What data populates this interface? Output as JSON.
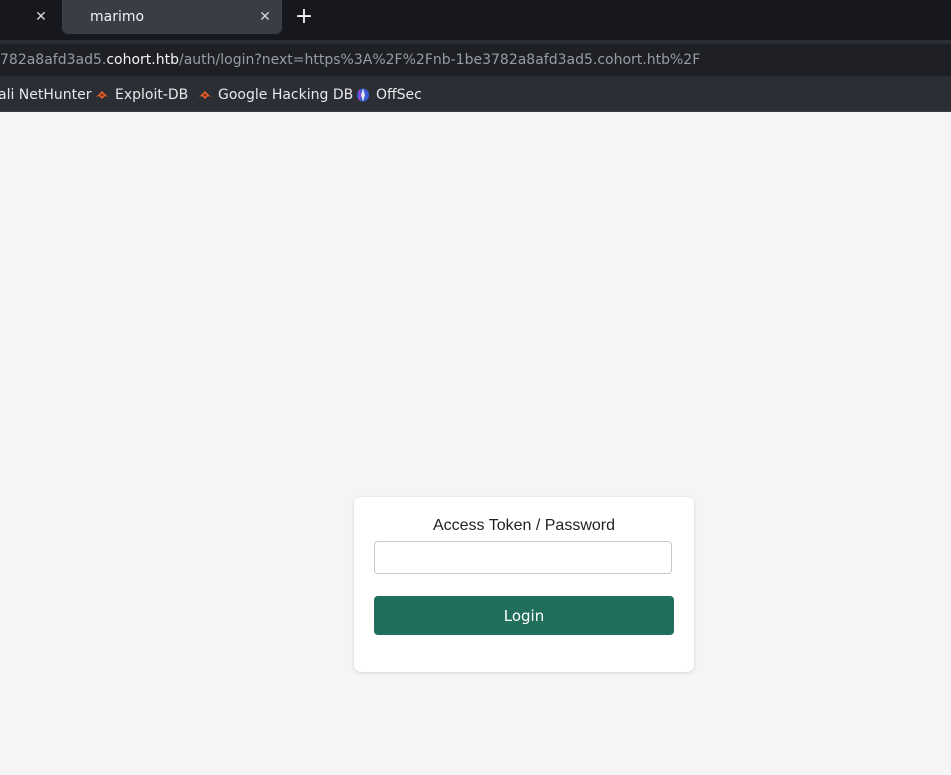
{
  "browser": {
    "active_tab_title": "marimo",
    "tab_close_glyph": "✕",
    "new_tab_glyph": "+",
    "url_prefix": "782a8afd3ad5.",
    "url_host": "cohort.htb",
    "url_path": "/auth/login?next=https%3A%2F%2Fnb-1be3782a8afd3ad5.cohort.htb%2F",
    "bookmarks": [
      {
        "label": "ali NetHunter",
        "icon": "none"
      },
      {
        "label": "Exploit-DB",
        "icon": "exploit-db-icon"
      },
      {
        "label": "Google Hacking DB",
        "icon": "ghdb-icon"
      },
      {
        "label": "OffSec",
        "icon": "offsec-icon"
      }
    ]
  },
  "login": {
    "label": "Access Token / Password",
    "input_value": "",
    "button_label": "Login"
  },
  "colors": {
    "accent": "#1f6f5c",
    "page_background": "#f5f5f7",
    "chrome_dark": "#16181d"
  }
}
